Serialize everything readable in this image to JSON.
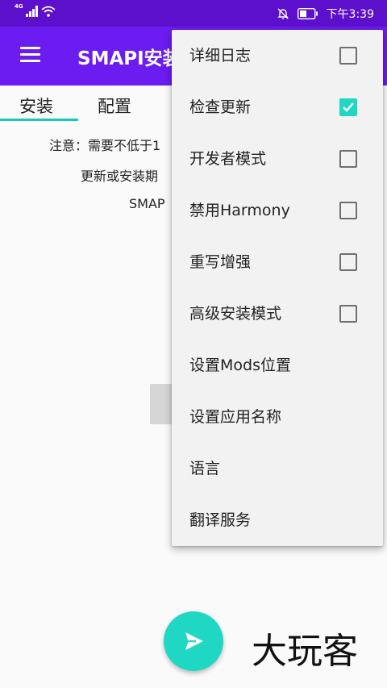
{
  "status_bar": {
    "network": "4G",
    "time": "下午3:39",
    "icons": [
      "signal-icon",
      "wifi-icon",
      "mute-icon",
      "battery-icon"
    ]
  },
  "app_bar": {
    "title": "SMAPI安装",
    "menu_icon": "hamburger-menu-icon"
  },
  "tabs": [
    {
      "label": "安装",
      "selected": true
    },
    {
      "label": "配置",
      "selected": false
    }
  ],
  "content": {
    "lines": [
      "注意：需要不低于1",
      "更新或安装期",
      "SMAP"
    ]
  },
  "fab": {
    "icon": "send-icon"
  },
  "watermark": {
    "text": "大玩客"
  },
  "menu": {
    "items": [
      {
        "label": "详细日志",
        "checkbox": true,
        "checked": false
      },
      {
        "label": "检查更新",
        "checkbox": true,
        "checked": true
      },
      {
        "label": "开发者模式",
        "checkbox": true,
        "checked": false
      },
      {
        "label": "禁用Harmony",
        "checkbox": true,
        "checked": false
      },
      {
        "label": "重写增强",
        "checkbox": true,
        "checked": false
      },
      {
        "label": "高级安装模式",
        "checkbox": true,
        "checked": false
      },
      {
        "label": "设置Mods位置",
        "checkbox": false
      },
      {
        "label": "设置应用名称",
        "checkbox": false
      },
      {
        "label": "语言",
        "checkbox": false
      },
      {
        "label": "翻译服务",
        "checkbox": false
      }
    ]
  },
  "colors": {
    "status_bar": "#5c10cc",
    "app_bar": "#6b1cf0",
    "accent": "#1ed8c4",
    "menu_bg": "#f2f2f2"
  }
}
